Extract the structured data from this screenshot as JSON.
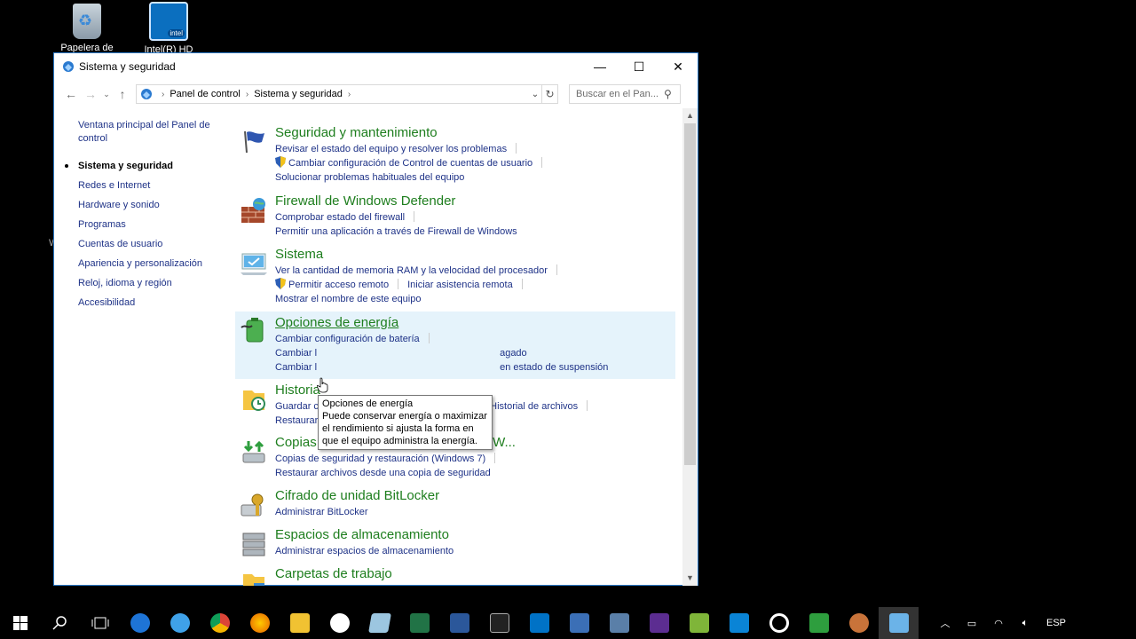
{
  "desktop": {
    "icons": [
      {
        "label": "Papelera de"
      },
      {
        "label": "Intel(R) HD"
      }
    ],
    "side_text": "W"
  },
  "window": {
    "title": "Sistema y seguridad",
    "buttons": {
      "minimize": "—",
      "maximize": "☐",
      "close": "✕"
    },
    "address": {
      "crumbs": [
        "Panel de control",
        "Sistema y seguridad"
      ],
      "search_placeholder": "Buscar en el Pan..."
    },
    "leftnav": {
      "home": "Ventana principal del Panel de control",
      "items": [
        {
          "label": "Sistema y seguridad",
          "current": true
        },
        {
          "label": "Redes e Internet"
        },
        {
          "label": "Hardware y sonido"
        },
        {
          "label": "Programas"
        },
        {
          "label": "Cuentas de usuario"
        },
        {
          "label": "Apariencia y personalización"
        },
        {
          "label": "Reloj, idioma y región"
        },
        {
          "label": "Accesibilidad"
        }
      ]
    },
    "categories": {
      "security": {
        "title": "Seguridad y mantenimiento",
        "links": [
          "Revisar el estado del equipo y resolver los problemas",
          "Cambiar configuración de Control de cuentas de usuario",
          "Solucionar problemas habituales del equipo"
        ]
      },
      "firewall": {
        "title": "Firewall de Windows Defender",
        "links": [
          "Comprobar estado del firewall",
          "Permitir una aplicación a través de Firewall de Windows"
        ]
      },
      "system": {
        "title": "Sistema",
        "links": [
          "Ver la cantidad de memoria RAM y la velocidad del procesador",
          "Permitir acceso remoto",
          "Iniciar asistencia remota",
          "Mostrar el nombre de este equipo"
        ]
      },
      "power": {
        "title": "Opciones de energía",
        "links": [
          "Cambiar configuración de batería",
          "Cambiar l",
          "agado",
          "Cambiar l",
          "en estado de suspensión"
        ]
      },
      "history": {
        "title": "Historia",
        "links": [
          "Guardar copias de seguridad de los archivos con Historial de archivos",
          "Restaurar los archivos con Historial de archivos"
        ]
      },
      "backup": {
        "title": "Copias de seguridad y restauración (W...",
        "links": [
          "Copias de seguridad y restauración (Windows 7)",
          "Restaurar archivos desde una copia de seguridad"
        ]
      },
      "bitlocker": {
        "title": "Cifrado de unidad BitLocker",
        "links": [
          "Administrar BitLocker"
        ]
      },
      "storage": {
        "title": "Espacios de almacenamiento",
        "links": [
          "Administrar espacios de almacenamiento"
        ]
      },
      "workfolders": {
        "title": "Carpetas de trabajo",
        "links": []
      }
    },
    "tooltip": {
      "title": "Opciones de energía",
      "body": "Puede conservar energía o maximizar el rendimiento si ajusta la forma en que el equipo administra la energía."
    }
  },
  "taskbar": {
    "tray": {
      "language": "ESP"
    }
  }
}
